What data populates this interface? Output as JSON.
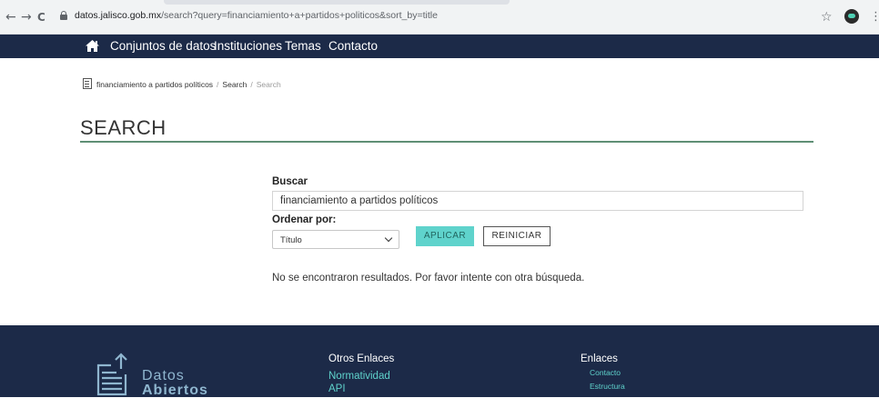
{
  "browser": {
    "back_glyph": "←",
    "forward_glyph": "→",
    "reload_glyph": "C",
    "url_host": "datos.jalisco.gob.mx",
    "url_path": "/search?query=financiamiento+a+partidos+politicos&sort_by=title",
    "star_glyph": "☆",
    "menu_glyph": "⋮"
  },
  "navbar": {
    "items": [
      {
        "label": "Conjuntos de datos"
      },
      {
        "label": "Instituciones"
      },
      {
        "label": "Temas"
      },
      {
        "label": "Contacto"
      }
    ]
  },
  "breadcrumb": {
    "items": [
      "financiamiento a partidos políticos",
      "Search",
      "Search"
    ],
    "separator": "/"
  },
  "page": {
    "title": "SEARCH"
  },
  "form": {
    "search_label": "Buscar",
    "search_value": "financiamiento a partidos políticos",
    "sort_label": "Ordenar por:",
    "sort_selected": "Título",
    "apply_label": "APLICAR",
    "reset_label": "REINICIAR"
  },
  "results": {
    "message": "No se encontraron resultados. Por favor intente con otra búsqueda."
  },
  "footer": {
    "logo_line1": "Datos",
    "logo_line2": "Abiertos",
    "col1_heading": "Otros Enlaces",
    "col1_links": [
      "Normatividad",
      "API"
    ],
    "col2_heading": "Enlaces",
    "col2_links": [
      "Contacto",
      "Estructura"
    ]
  },
  "colors": {
    "navbar_bg": "#1c2a48",
    "accent_teal": "#5fd3cc",
    "title_rule": "#5f8f75"
  },
  "icons": [
    "back-arrow-icon",
    "forward-arrow-icon",
    "reload-icon",
    "lock-icon",
    "bookmark-star-icon",
    "profile-icon",
    "menu-icon",
    "home-icon",
    "dataset-icon",
    "chevron-down-icon",
    "datos-abiertos-logo-icon"
  ]
}
